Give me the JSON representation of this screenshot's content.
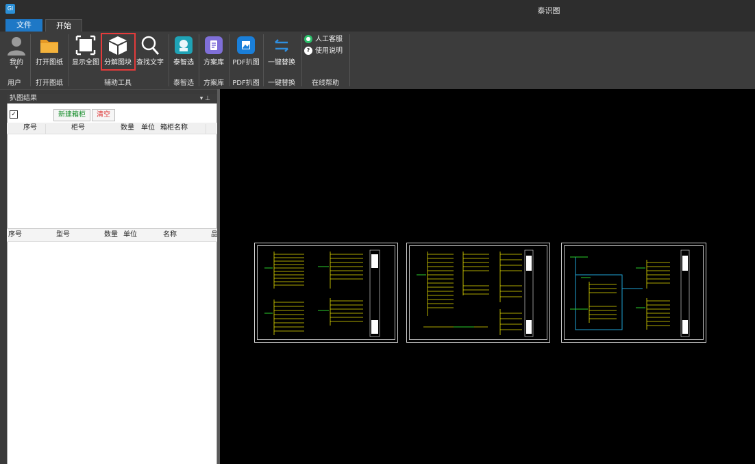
{
  "app": {
    "title": "泰识图",
    "icon_label": "GI"
  },
  "tabs": {
    "file": "文件",
    "home": "开始"
  },
  "ribbon": {
    "buttons": {
      "me": "我的",
      "open": "打开图纸",
      "fit": "显示全图",
      "explode": "分解图块",
      "find": "查找文字",
      "taizhixuan": "泰智选",
      "schemes": "方案库",
      "pdf": "PDF扒图",
      "replace": "一键替换"
    },
    "groups": {
      "user": "用户",
      "open": "打开图纸",
      "tools": "辅助工具",
      "taizhixuan": "泰智选",
      "schemes": "方案库",
      "pdf": "PDF扒图",
      "replace": "一键替换",
      "help": "在线帮助"
    },
    "help": {
      "service": "人工客服",
      "manual": "使用说明"
    }
  },
  "panel": {
    "title": "扒图结果",
    "pin": "▾ ⊥",
    "new_cabinet": "新建箱柜",
    "clear": "清空",
    "table1_headers": [
      "序号",
      "柜号",
      "数量",
      "单位",
      "箱柜名称"
    ],
    "table2_headers": [
      "序号",
      "型号",
      "数量",
      "单位",
      "名称",
      "品"
    ]
  },
  "colors": {
    "accent": "#1e78c6",
    "highlight": "#e53b3b",
    "canvas_bg": "#000000"
  }
}
